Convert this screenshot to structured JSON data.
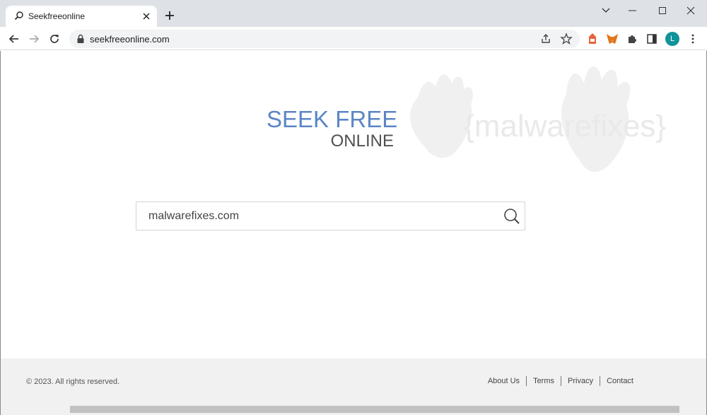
{
  "browser": {
    "tab_title": "Seekfreeonline",
    "url": "seekfreeonline.com"
  },
  "page": {
    "logo_line1": "SEEK FREE",
    "logo_line2": "ONLINE",
    "search_value": "malwarefixes.com",
    "watermark_text": "{malwarefixes}"
  },
  "footer": {
    "copyright": "© 2023. All rights reserved.",
    "links": [
      "About Us",
      "Terms",
      "Privacy",
      "Contact"
    ]
  },
  "icons": {
    "tab_favicon": "search-icon",
    "profile_initial": "L"
  },
  "colors": {
    "logo_blue": "#5b86c5",
    "logo_grey": "#505050",
    "avatar": "#12939a"
  }
}
